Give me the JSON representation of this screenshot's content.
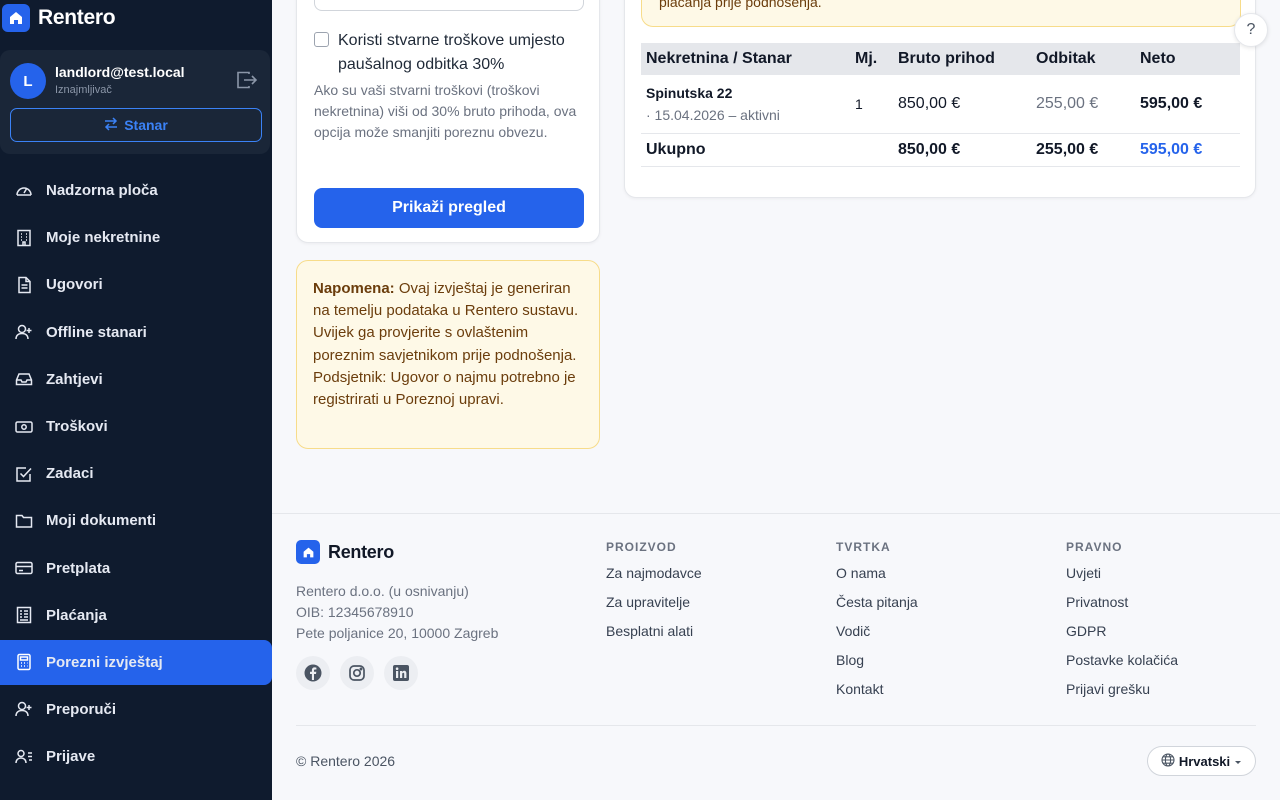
{
  "brand": {
    "name": "Rentero"
  },
  "user": {
    "initial": "L",
    "email": "landlord@test.local",
    "role": "Iznajmljivač",
    "switch_label": "Stanar"
  },
  "nav": {
    "items": [
      {
        "label": "Nadzorna ploča",
        "icon": "gauge-icon"
      },
      {
        "label": "Moje nekretnine",
        "icon": "building-icon"
      },
      {
        "label": "Ugovori",
        "icon": "document-icon"
      },
      {
        "label": "Offline stanari",
        "icon": "user-plus-icon"
      },
      {
        "label": "Zahtjevi",
        "icon": "inbox-icon"
      },
      {
        "label": "Troškovi",
        "icon": "cash-icon"
      },
      {
        "label": "Zadaci",
        "icon": "checkbox-icon"
      },
      {
        "label": "Moji dokumenti",
        "icon": "folder-icon"
      },
      {
        "label": "Pretplata",
        "icon": "credit-card-icon"
      },
      {
        "label": "Plaćanja",
        "icon": "receipt-icon"
      },
      {
        "label": "Porezni izvještaj",
        "icon": "calculator-icon",
        "active": true
      },
      {
        "label": "Preporuči",
        "icon": "user-plus-icon"
      },
      {
        "label": "Prijave",
        "icon": "user-list-icon"
      }
    ]
  },
  "form": {
    "checkbox_label": "Koristi stvarne troškove umjesto paušalnog odbitka 30%",
    "checkbox_checked": false,
    "help_text": "Ako su vaši stvarni troškovi (troškovi nekretnina) viši od 30% bruto prihoda, ova opcija može smanjiti poreznu obvezu.",
    "submit_label": "Prikaži pregled"
  },
  "note": {
    "title": "Napomena:",
    "text": " Ovaj izvještaj je generiran na temelju podataka u Rentero sustavu. Uvijek ga provjerite s ovlaštenim poreznim savjetnikom prije podnošenja. Podsjetnik: Ugovor o najmu potrebno je registrirati u Poreznoj upravi."
  },
  "report": {
    "warning_partial": "plaćanja prije podnošenja.",
    "columns": [
      "Nekretnina / Stanar",
      "Mj.",
      "Bruto prihod",
      "Odbitak",
      "Neto"
    ],
    "rows": [
      {
        "property": "Spinutska 22",
        "subtitle": "· 15.04.2026 – aktivni",
        "months": "1",
        "gross": "850,00 €",
        "deduction": "255,00 €",
        "net": "595,00 €"
      }
    ],
    "total": {
      "label": "Ukupno",
      "gross": "850,00 €",
      "deduction": "255,00 €",
      "net": "595,00 €"
    }
  },
  "help_fab": "?",
  "footer": {
    "brand": "Rentero",
    "company_lines": [
      "Rentero d.o.o. (u osnivanju)",
      "OIB: 12345678910",
      "Pete poljanice 20, 10000 Zagreb"
    ],
    "socials": [
      "facebook-icon",
      "instagram-icon",
      "linkedin-icon"
    ],
    "columns": [
      {
        "title": "PROIZVOD",
        "links": [
          "Za najmodavce",
          "Za upravitelje",
          "Besplatni alati"
        ]
      },
      {
        "title": "TVRTKA",
        "links": [
          "O nama",
          "Česta pitanja",
          "Vodič",
          "Blog",
          "Kontakt"
        ]
      },
      {
        "title": "PRAVNO",
        "links": [
          "Uvjeti",
          "Privatnost",
          "GDPR",
          "Postavke kolačića",
          "Prijavi grešku"
        ]
      }
    ],
    "copyright": "© Rentero 2026",
    "language": "Hrvatski"
  },
  "colors": {
    "accent": "#2563eb",
    "sidebar_bg": "#0f1b2e",
    "note_bg": "#fef9e7"
  }
}
